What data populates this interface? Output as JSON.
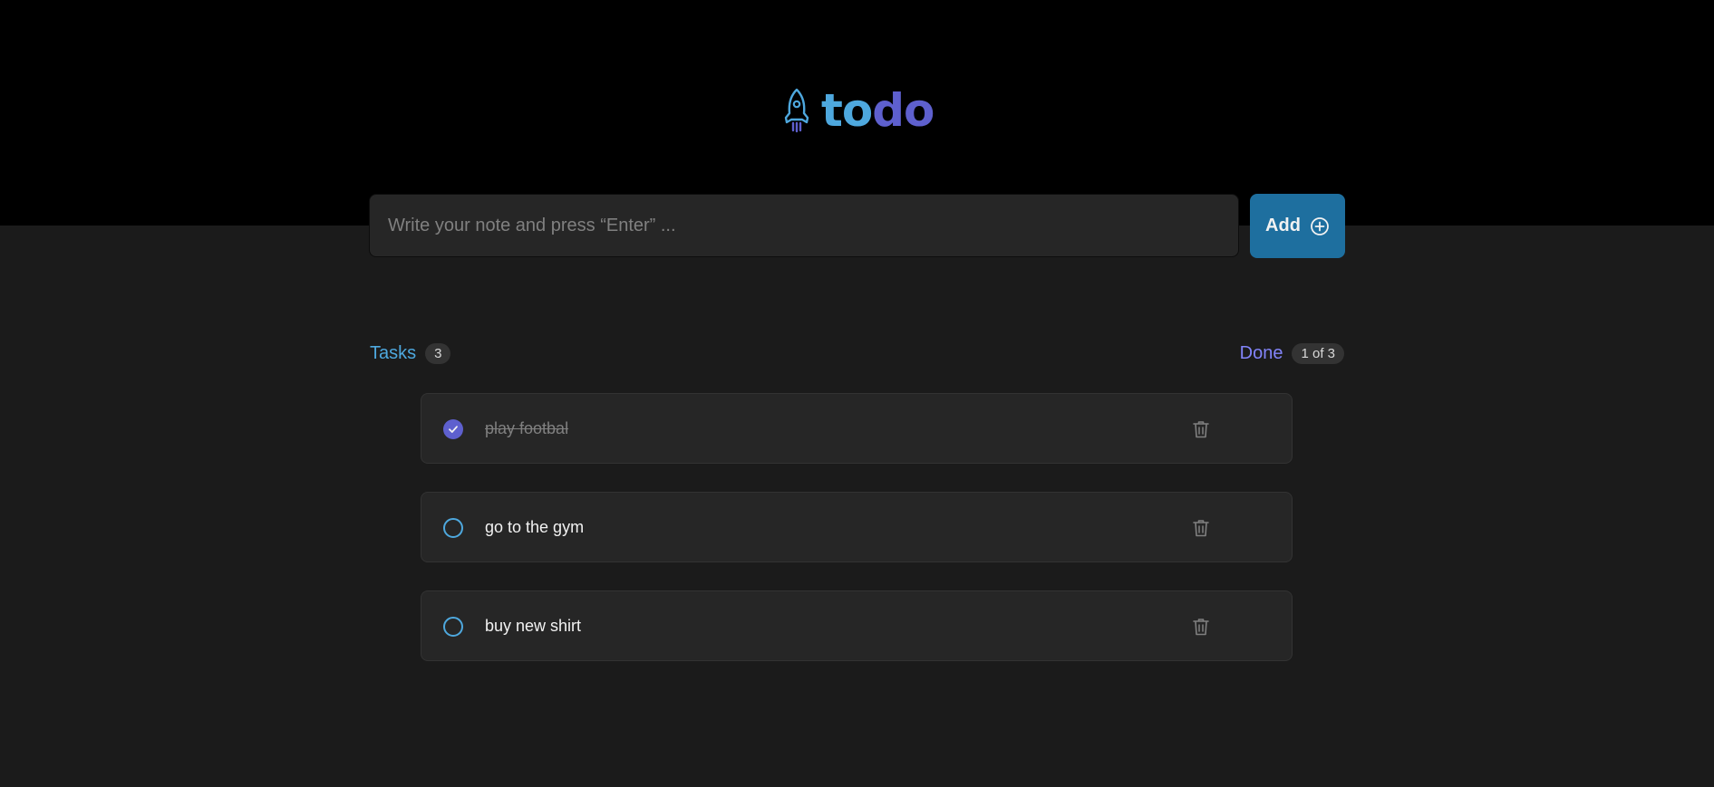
{
  "header": {
    "logo": {
      "part1": "to",
      "part2": "do",
      "icon": "rocket-icon"
    }
  },
  "new_task": {
    "placeholder": "Write your note and press “Enter” ...",
    "value": "",
    "add_label": "Add",
    "add_icon": "plus-circle-icon"
  },
  "summary": {
    "tasks_label": "Tasks",
    "tasks_count": "3",
    "done_label": "Done",
    "done_count": "1 of 3"
  },
  "tasks": [
    {
      "text": "play footbal",
      "completed": true
    },
    {
      "text": "go to the gym",
      "completed": false
    },
    {
      "text": "buy new shirt",
      "completed": false
    }
  ],
  "colors": {
    "background": "#1b1b1b",
    "header_bg": "#000000",
    "blue": "#4ea8de",
    "purple": "#5e60ce",
    "purple_light": "#8284fa",
    "button_blue": "#1e6f9f",
    "card_bg": "#262626",
    "muted": "#808080"
  }
}
